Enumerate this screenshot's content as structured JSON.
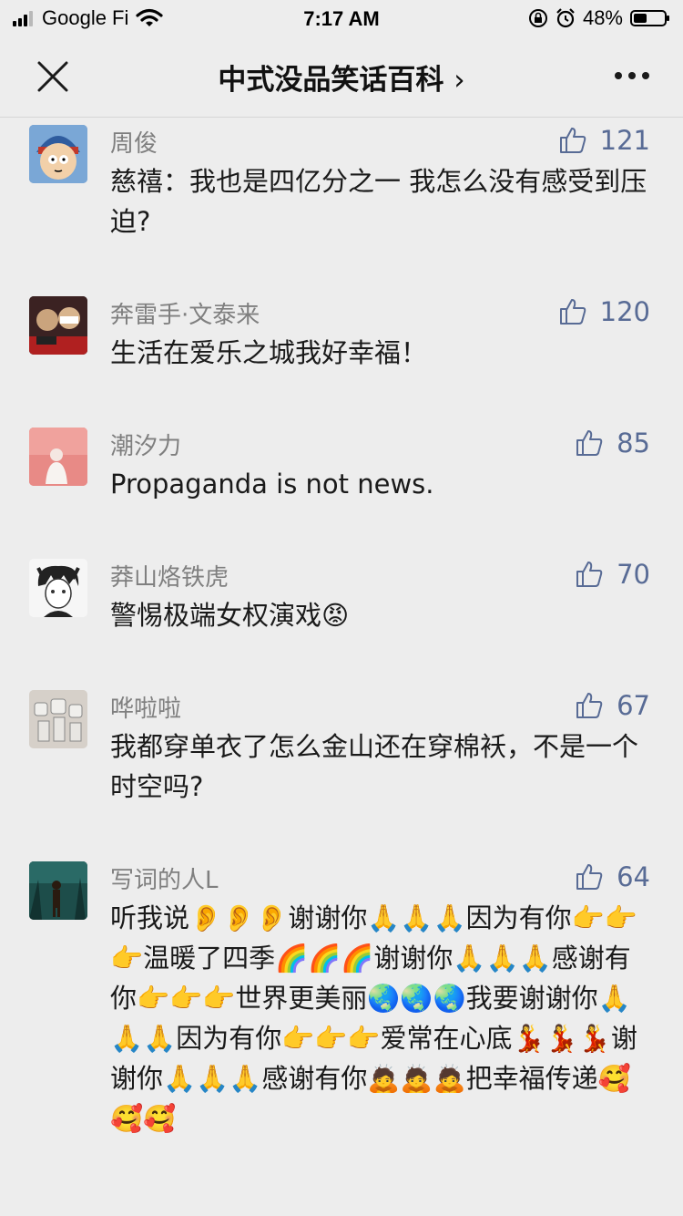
{
  "status_bar": {
    "carrier": "Google Fi",
    "time": "7:17 AM",
    "battery": "48%",
    "battery_level": 0.48
  },
  "nav": {
    "title": "中式没品笑话百科",
    "title_chevron": "›",
    "close_icon": "close-icon",
    "more_icon": "more-icon"
  },
  "comments": [
    {
      "name": "周俊",
      "likes": "121",
      "text": "慈禧：我也是四亿分之一 我怎么没有感受到压迫?"
    },
    {
      "name": "奔雷手·文泰来",
      "likes": "120",
      "text": "生活在爱乐之城我好幸福！"
    },
    {
      "name": "潮汐力",
      "likes": "85",
      "text": "Propaganda is not news."
    },
    {
      "name": "莽山烙铁虎",
      "likes": "70",
      "text": "警惕极端女权演戏😡"
    },
    {
      "name": "哗啦啦",
      "likes": "67",
      "text": "我都穿单衣了怎么金山还在穿棉袄，不是一个时空吗?"
    },
    {
      "name": "写词的人L",
      "likes": "64",
      "text": "听我说👂👂👂谢谢你🙏🙏🙏因为有你👉👉👉温暖了四季🌈🌈🌈谢谢你🙏🙏🙏感谢有你👉👉👉世界更美丽🌏🌏🌏我要谢谢你🙏🙏🙏因为有你👉👉👉爱常在心底💃💃💃谢谢你🙏🙏🙏感谢有你🙇🙇🙇把幸福传递🥰🥰🥰"
    }
  ]
}
